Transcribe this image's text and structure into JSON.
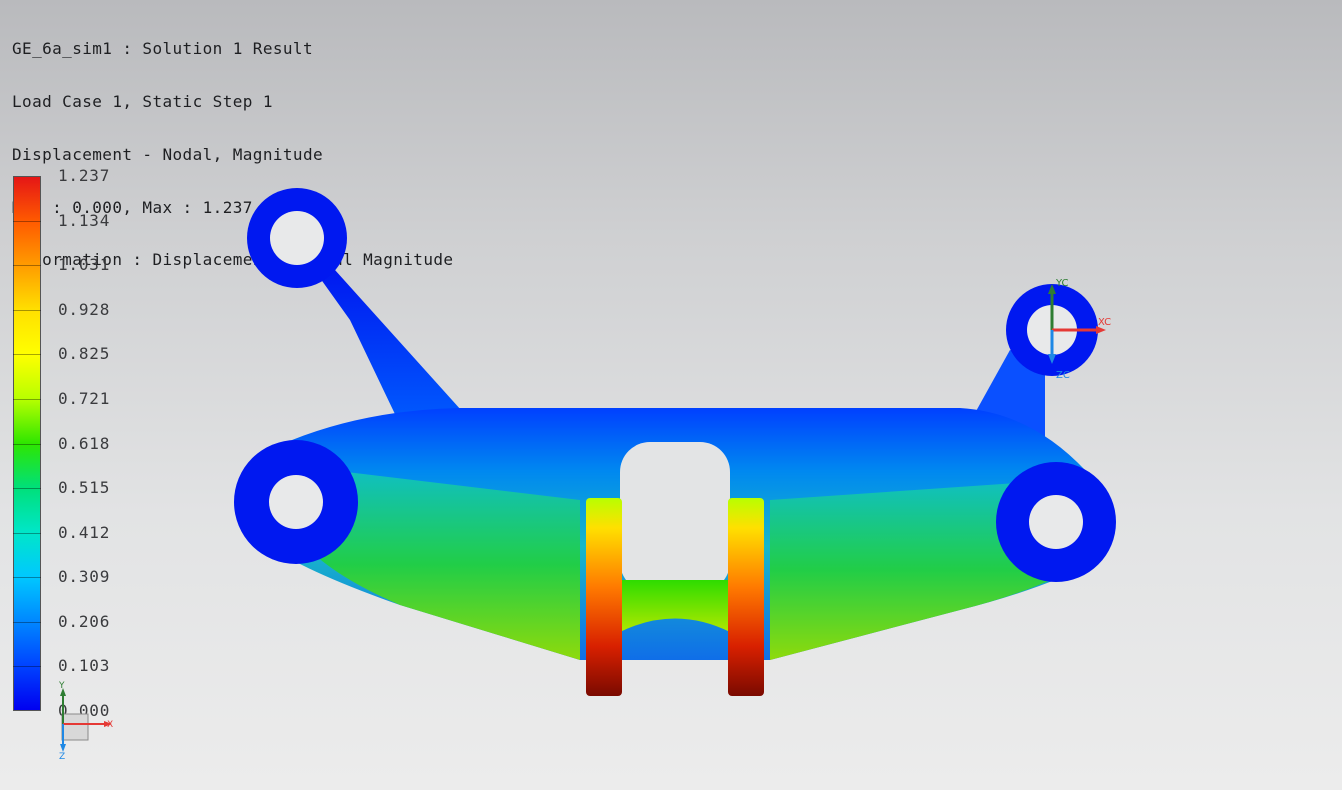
{
  "header": {
    "lines": [
      "GE_6a_sim1 : Solution 1 Result",
      "Load Case 1, Static Step 1",
      "Displacement - Nodal, Magnitude",
      "Min : 0.000, Max : 1.237, mm",
      "Deformation : Displacement - Nodal Magnitude"
    ]
  },
  "legend": {
    "values": [
      "1.237",
      "1.134",
      "1.031",
      "0.928",
      "0.825",
      "0.721",
      "0.618",
      "0.515",
      "0.412",
      "0.309",
      "0.206",
      "0.103",
      "0.000"
    ],
    "colors": [
      "#e51616",
      "#ff5a00",
      "#ff9c00",
      "#ffe000",
      "#ffff00",
      "#b8ff00",
      "#2ee600",
      "#00e07a",
      "#00e6c8",
      "#00c8ff",
      "#0088ff",
      "#0044ff",
      "#0000f0"
    ]
  },
  "triad_main": {
    "y_label": "YC",
    "x_label": "XC",
    "z_label": "ZC"
  },
  "triad_small": {
    "y_label": "Y",
    "x_label": "X",
    "z_label": "Z"
  }
}
